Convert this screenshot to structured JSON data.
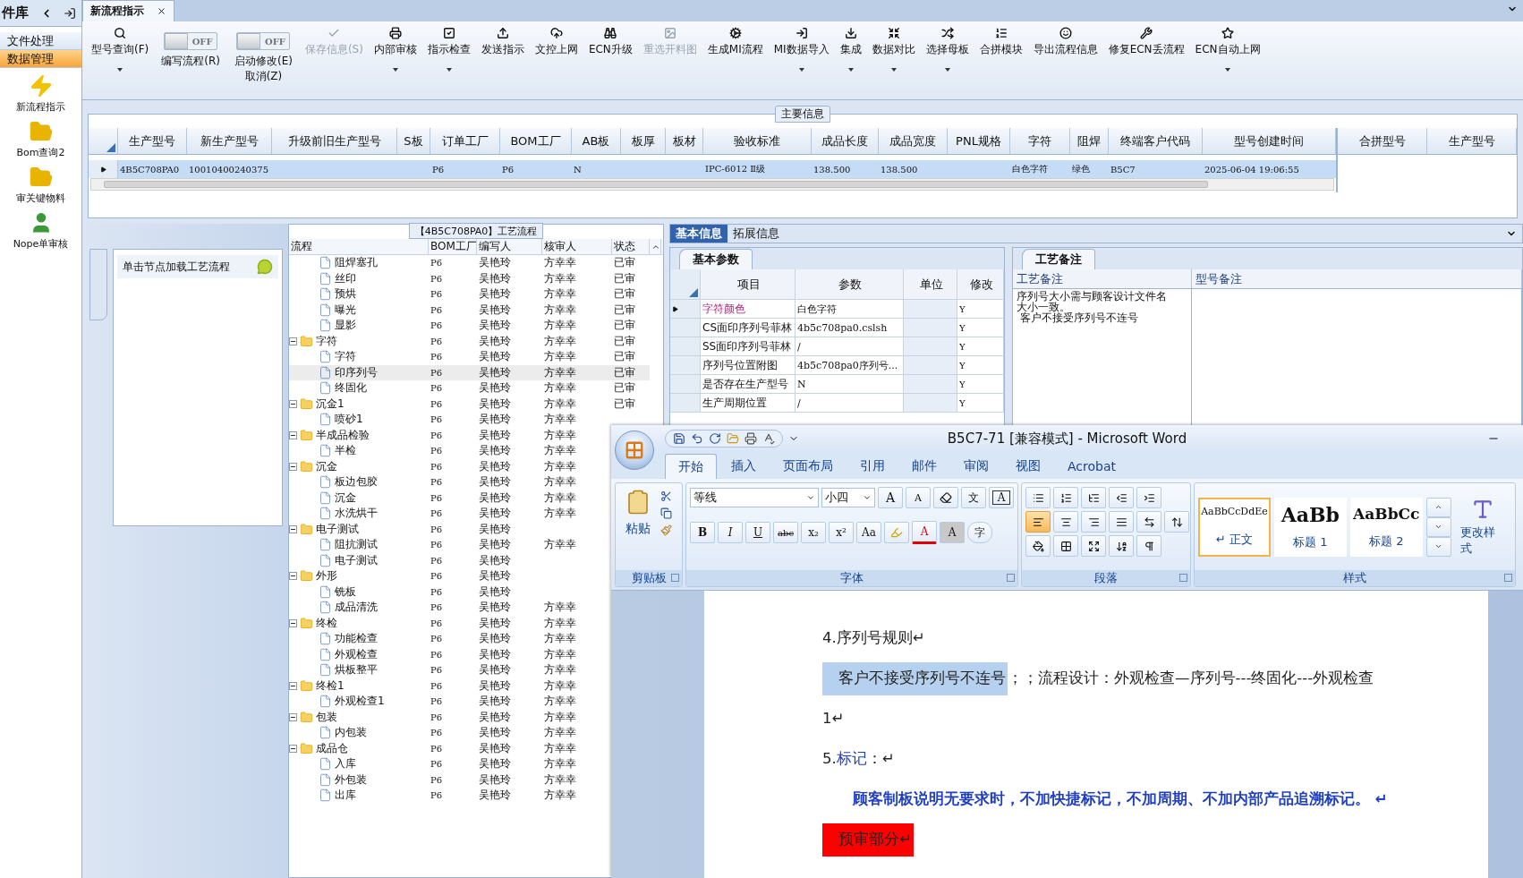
{
  "sidebar": {
    "title": "件库",
    "items": [
      {
        "kind": "text",
        "label": "文件处理",
        "selected": false
      },
      {
        "kind": "text",
        "label": "数据管理",
        "selected": true
      },
      {
        "kind": "icon",
        "label": "新流程指示",
        "selected": false
      },
      {
        "kind": "icon",
        "label": "Bom查询2",
        "selected": false
      },
      {
        "kind": "icon",
        "label": "审关键物料",
        "selected": false
      },
      {
        "kind": "icon",
        "label": "Nope单审核",
        "selected": false
      }
    ]
  },
  "tabs": [
    {
      "label": "新流程指示",
      "selected": true
    }
  ],
  "toolbar": [
    {
      "kind": "button",
      "label": "型号查询(F)",
      "dropdown": true,
      "disabled": false
    },
    {
      "kind": "toggle",
      "switch": "OFF",
      "on": false,
      "label": "编写流程(R)"
    },
    {
      "kind": "toggle",
      "switch": "OFF",
      "on": false,
      "label": "启动修改(E)",
      "label2": "取消(Z)"
    },
    {
      "kind": "button",
      "label": "保存信息(S)",
      "dropdown": false,
      "disabled": true
    },
    {
      "kind": "button",
      "label": "内部审核",
      "dropdown": true,
      "disabled": false
    },
    {
      "kind": "button",
      "label": "指示检查",
      "dropdown": true,
      "disabled": false
    },
    {
      "kind": "button",
      "label": "发送指示",
      "dropdown": false,
      "disabled": false
    },
    {
      "kind": "button",
      "label": "文控上网",
      "dropdown": false,
      "disabled": false
    },
    {
      "kind": "button",
      "label": "ECN升级",
      "dropdown": false,
      "disabled": false
    },
    {
      "kind": "button",
      "label": "重选开料图",
      "dropdown": false,
      "disabled": true
    },
    {
      "kind": "button",
      "label": "生成MI流程",
      "dropdown": false,
      "disabled": false
    },
    {
      "kind": "button",
      "label": "MI数据导入",
      "dropdown": true,
      "disabled": false
    },
    {
      "kind": "button",
      "label": "集成",
      "dropdown": true,
      "disabled": false
    },
    {
      "kind": "button",
      "label": "数据对比",
      "dropdown": true,
      "disabled": false
    },
    {
      "kind": "button",
      "label": "选择母板",
      "dropdown": true,
      "disabled": false
    },
    {
      "kind": "button",
      "label": "合拼模块",
      "dropdown": false,
      "disabled": false
    },
    {
      "kind": "button",
      "label": "导出流程信息",
      "dropdown": false,
      "disabled": false
    },
    {
      "kind": "button",
      "label": "修复ECN丢流程",
      "dropdown": false,
      "disabled": false
    },
    {
      "kind": "button",
      "label": "ECN自动上网",
      "dropdown": true,
      "disabled": false
    }
  ],
  "main_info": {
    "title": "主要信息",
    "columns": [
      "生产型号",
      "新生产型号",
      "升级前旧生产型号",
      "S板",
      "订单工厂",
      "BOM工厂",
      "AB板",
      "板厚",
      "板材",
      "验收标准",
      "成品长度",
      "成品宽度",
      "PNL规格",
      "字符",
      "阻焊",
      "终端客户代码",
      "型号创建时间"
    ],
    "rows": [
      {
        "selected": true,
        "cells": [
          "4B5C708PA0",
          "10010400240375",
          null,
          null,
          "P6",
          "P6",
          "N",
          null,
          null,
          "IPC-6012 Ⅱ级",
          "138.500",
          "138.500",
          null,
          "白色字符",
          "绿色",
          "B5C7",
          "2025-06-04 19:06:55"
        ]
      }
    ],
    "side_columns": [
      "合拼型号",
      "生产型号"
    ]
  },
  "process": {
    "title": "【4B5C708PA0】工艺流程",
    "hint": "单击节点加载工艺流程",
    "columns": [
      "流程",
      "BOM工厂",
      "编写人",
      "核审人",
      "状态"
    ],
    "nodes": [
      {
        "children": [
          {
            "label": "阻焊塞孔",
            "bom": "P6",
            "writer": "吴艳玲",
            "reviewer": "方幸幸",
            "status": "已审",
            "selected": false
          },
          {
            "label": "丝印",
            "bom": "P6",
            "writer": "吴艳玲",
            "reviewer": "方幸幸",
            "status": "已审",
            "selected": false
          },
          {
            "label": "预烘",
            "bom": "P6",
            "writer": "吴艳玲",
            "reviewer": "方幸幸",
            "status": "已审",
            "selected": false
          },
          {
            "label": "曝光",
            "bom": "P6",
            "writer": "吴艳玲",
            "reviewer": "方幸幸",
            "status": "已审",
            "selected": false
          },
          {
            "label": "显影",
            "bom": "P6",
            "writer": "吴艳玲",
            "reviewer": "方幸幸",
            "status": "已审",
            "selected": false
          }
        ]
      },
      {
        "label": "字符",
        "bom": "P6",
        "writer": "吴艳玲",
        "reviewer": "方幸幸",
        "status": "已审",
        "selected": false,
        "expanded": true,
        "children": [
          {
            "label": "字符",
            "bom": "P6",
            "writer": "吴艳玲",
            "reviewer": "方幸幸",
            "status": "已审",
            "selected": false
          },
          {
            "label": "印序列号",
            "bom": "P6",
            "writer": "吴艳玲",
            "reviewer": "方幸幸",
            "status": "已审",
            "selected": true
          },
          {
            "label": "终固化",
            "bom": "P6",
            "writer": "吴艳玲",
            "reviewer": "方幸幸",
            "status": "已审",
            "selected": false
          }
        ]
      },
      {
        "label": "沉金1",
        "bom": "P6",
        "writer": "吴艳玲",
        "reviewer": "方幸幸",
        "status": "已审",
        "selected": false,
        "expanded": true,
        "children": [
          {
            "label": "喷砂1",
            "bom": "P6",
            "writer": "吴艳玲",
            "reviewer": "方幸幸",
            "selected": false
          }
        ]
      },
      {
        "label": "半成品检验",
        "bom": "P6",
        "writer": "吴艳玲",
        "reviewer": "方幸幸",
        "selected": false,
        "expanded": true,
        "children": [
          {
            "label": "半检",
            "bom": "P6",
            "writer": "吴艳玲",
            "reviewer": "方幸幸",
            "selected": false
          }
        ]
      },
      {
        "label": "沉金",
        "bom": "P6",
        "writer": "吴艳玲",
        "reviewer": "方幸幸",
        "selected": false,
        "expanded": true,
        "children": [
          {
            "label": "板边包胶",
            "bom": "P6",
            "writer": "吴艳玲",
            "reviewer": "方幸幸",
            "selected": false
          },
          {
            "label": "沉金",
            "bom": "P6",
            "writer": "吴艳玲",
            "reviewer": "方幸幸",
            "selected": false
          },
          {
            "label": "水洗烘干",
            "bom": "P6",
            "writer": "吴艳玲",
            "reviewer": "方幸幸",
            "selected": false
          }
        ]
      },
      {
        "label": "电子测试",
        "bom": "P6",
        "writer": "吴艳玲",
        "selected": false,
        "expanded": true,
        "children": [
          {
            "label": "阻抗测试",
            "bom": "P6",
            "writer": "吴艳玲",
            "reviewer": "方幸幸",
            "selected": false
          },
          {
            "label": "电子测试",
            "bom": "P6",
            "writer": "吴艳玲",
            "selected": false
          }
        ]
      },
      {
        "label": "外形",
        "bom": "P6",
        "writer": "吴艳玲",
        "selected": false,
        "expanded": true,
        "children": [
          {
            "label": "铣板",
            "bom": "P6",
            "writer": "吴艳玲",
            "selected": false
          },
          {
            "label": "成品清洗",
            "bom": "P6",
            "writer": "吴艳玲",
            "reviewer": "方幸幸",
            "selected": false
          }
        ]
      },
      {
        "label": "终检",
        "bom": "P6",
        "writer": "吴艳玲",
        "reviewer": "方幸幸",
        "selected": false,
        "expanded": true,
        "children": [
          {
            "label": "功能检查",
            "bom": "P6",
            "writer": "吴艳玲",
            "reviewer": "方幸幸",
            "selected": false
          },
          {
            "label": "外观检查",
            "bom": "P6",
            "writer": "吴艳玲",
            "reviewer": "方幸幸",
            "selected": false
          },
          {
            "label": "烘板整平",
            "bom": "P6",
            "writer": "吴艳玲",
            "reviewer": "方幸幸",
            "selected": false
          }
        ]
      },
      {
        "label": "终检1",
        "bom": "P6",
        "writer": "吴艳玲",
        "reviewer": "方幸幸",
        "selected": false,
        "expanded": true,
        "children": [
          {
            "label": "外观检查1",
            "bom": "P6",
            "writer": "吴艳玲",
            "reviewer": "方幸幸",
            "selected": false
          }
        ]
      },
      {
        "label": "包装",
        "bom": "P6",
        "writer": "吴艳玲",
        "reviewer": "方幸幸",
        "selected": false,
        "expanded": true,
        "children": [
          {
            "label": "内包装",
            "bom": "P6",
            "writer": "吴艳玲",
            "reviewer": "方幸幸",
            "selected": false
          }
        ]
      },
      {
        "label": "成品仓",
        "bom": "P6",
        "writer": "吴艳玲",
        "reviewer": "方幸幸",
        "selected": false,
        "expanded": true,
        "children": [
          {
            "label": "入库",
            "bom": "P6",
            "writer": "吴艳玲",
            "reviewer": "方幸幸",
            "selected": false
          },
          {
            "label": "外包装",
            "bom": "P6",
            "writer": "吴艳玲",
            "reviewer": "方幸幸",
            "selected": false
          },
          {
            "label": "出库",
            "bom": "P6",
            "writer": "吴艳玲",
            "reviewer": "方幸幸",
            "selected": false
          }
        ]
      }
    ]
  },
  "detail": {
    "tabs": [
      {
        "label": "基本信息",
        "selected": true
      },
      {
        "label": "拓展信息",
        "selected": false
      }
    ],
    "params": {
      "tab": "基本参数",
      "columns": [
        "项目",
        "参数",
        "单位",
        "修改"
      ],
      "rows": [
        {
          "item": "字符颜色",
          "value": "白色字符",
          "modified": "Y",
          "selected": true
        },
        {
          "item": "CS面印序列号菲林",
          "value": "4b5c708pa0.cslsh",
          "modified": "Y",
          "selected": false
        },
        {
          "item": "SS面印序列号菲林",
          "value": "/",
          "modified": "Y",
          "selected": false
        },
        {
          "item": "序列号位置附图",
          "value": "4b5c708pa0序列号...",
          "modified": "Y",
          "selected": false
        },
        {
          "item": "是否存在生产型号",
          "value": "N",
          "modified": "Y",
          "selected": false
        },
        {
          "item": "生产周期位置",
          "value": "/",
          "modified": "Y",
          "selected": false
        }
      ]
    },
    "notes": {
      "tab": "工艺备注",
      "columns": [
        "工艺备注",
        "型号备注"
      ],
      "text": [
        "序列号大小需与顾客设计文件名大小一致。",
        " 客户不接受序列号不连号"
      ]
    }
  },
  "word": {
    "title": "B5C7-71 [兼容模式] - Microsoft Word",
    "tabs": [
      {
        "label": "开始",
        "selected": true
      },
      {
        "label": "插入",
        "selected": false
      },
      {
        "label": "页面布局",
        "selected": false
      },
      {
        "label": "引用",
        "selected": false
      },
      {
        "label": "邮件",
        "selected": false
      },
      {
        "label": "审阅",
        "selected": false
      },
      {
        "label": "视图",
        "selected": false
      },
      {
        "label": "Acrobat",
        "selected": false
      }
    ],
    "clipboard": {
      "paste": "粘贴",
      "group": "剪贴板"
    },
    "font": {
      "name": "等线",
      "size": "小四",
      "group": "字体",
      "row1": [
        {
          "kind": "grow",
          "text": "A"
        },
        {
          "kind": "shrink",
          "text": "A"
        },
        {
          "kind": "clear"
        },
        {
          "kind": "phonetic",
          "text": "文"
        },
        {
          "kind": "border",
          "text": "A"
        }
      ],
      "row2": [
        {
          "kind": "bold",
          "text": "B"
        },
        {
          "kind": "italic",
          "text": "I"
        },
        {
          "kind": "underline",
          "text": "U"
        },
        {
          "kind": "strike",
          "text": "abc"
        },
        {
          "kind": "sub",
          "text": "x₂"
        },
        {
          "kind": "sup",
          "text": "x²"
        },
        {
          "kind": "case",
          "text": "Aa"
        },
        {
          "kind": "highlight"
        },
        {
          "kind": "color",
          "text": "A"
        },
        {
          "kind": "shading",
          "text": "A"
        },
        {
          "kind": "enclose",
          "text": "字"
        }
      ]
    },
    "paragraph": {
      "group": "段落",
      "alignments": [
        {
          "selected": true
        },
        {
          "selected": false
        },
        {
          "selected": false
        },
        {
          "selected": false
        },
        {
          "selected": false
        }
      ]
    },
    "styles": {
      "group": "样式",
      "change": "更改样式",
      "items": [
        {
          "preview": "AaBbCcDdEe",
          "label": "↵ 正文",
          "selected": true
        },
        {
          "preview": "AaBb",
          "label": "标题 1",
          "selected": false
        },
        {
          "preview": "AaBbCc",
          "label": "标题 2",
          "selected": false
        }
      ]
    },
    "document": [
      {
        "runs": [
          {
            "text": "4.序列号规则↵"
          }
        ]
      },
      {
        "runs": [
          {
            "text": "客户不接受序列号不连号",
            "kind": "highlight",
            "color": "#b6d1ef"
          },
          {
            "text": "；；流程设计：外观检查—序列号---终固化---外观检查 1↵"
          }
        ]
      },
      {
        "runs": [
          {
            "text": "5."
          },
          {
            "text": "标记",
            "kind": "plain",
            "color": "#1f3fbf"
          },
          {
            "text": "：↵"
          }
        ]
      },
      {
        "indent": true,
        "runs": [
          {
            "text": "顾客制板说明无要求时，不加快捷标记，不加周期、不加内部产品追溯标记。 ↵",
            "kind": "plain",
            "color": "#1f3fbf",
            "bold": true
          }
        ]
      },
      {
        "runs": [
          {
            "text": "预审部分↵",
            "kind": "highlight",
            "color": "#ff0000"
          }
        ]
      }
    ]
  }
}
